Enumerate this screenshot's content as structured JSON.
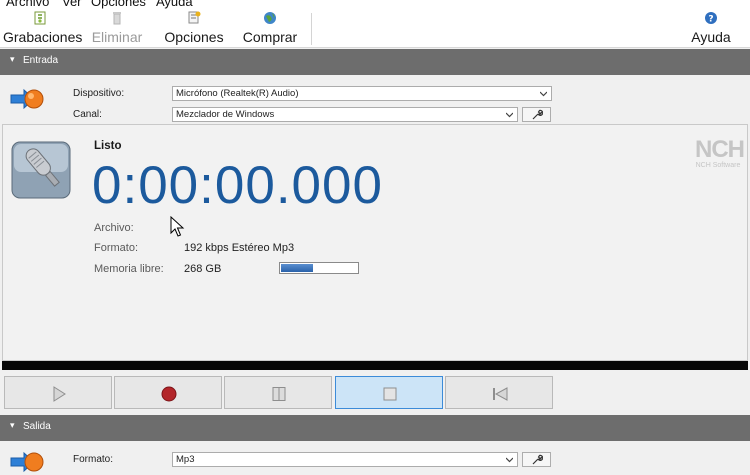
{
  "menu": [
    "Archivo",
    "Ver",
    "Opciones",
    "Ayuda"
  ],
  "toolbar": {
    "recordings": "Grabaciones",
    "delete": "Eliminar",
    "options": "Opciones",
    "buy": "Comprar",
    "help": "Ayuda"
  },
  "input": {
    "section_title": "Entrada",
    "device_label": "Dispositivo:",
    "device_value": "Micrófono (Realtek(R) Audio)",
    "channel_label": "Canal:",
    "channel_value": "Mezclador de Windows"
  },
  "display": {
    "status": "Listo",
    "timer": "0:00:00.000",
    "file_label": "Archivo:",
    "file_value": "",
    "format_label": "Formato:",
    "format_value": "192 kbps Estéreo Mp3",
    "memory_label": "Memoria libre:",
    "memory_value": "268 GB",
    "memory_used_fraction": 0.42,
    "logo_big": "NCH",
    "logo_small": "NCH Software"
  },
  "output": {
    "section_title": "Salida",
    "format_label": "Formato:",
    "format_value": "Mp3"
  },
  "colors": {
    "timer": "#1c5a9d",
    "section_header": "#6d6d6d",
    "active_button": "#cce4f7",
    "record": "#b3262a"
  }
}
